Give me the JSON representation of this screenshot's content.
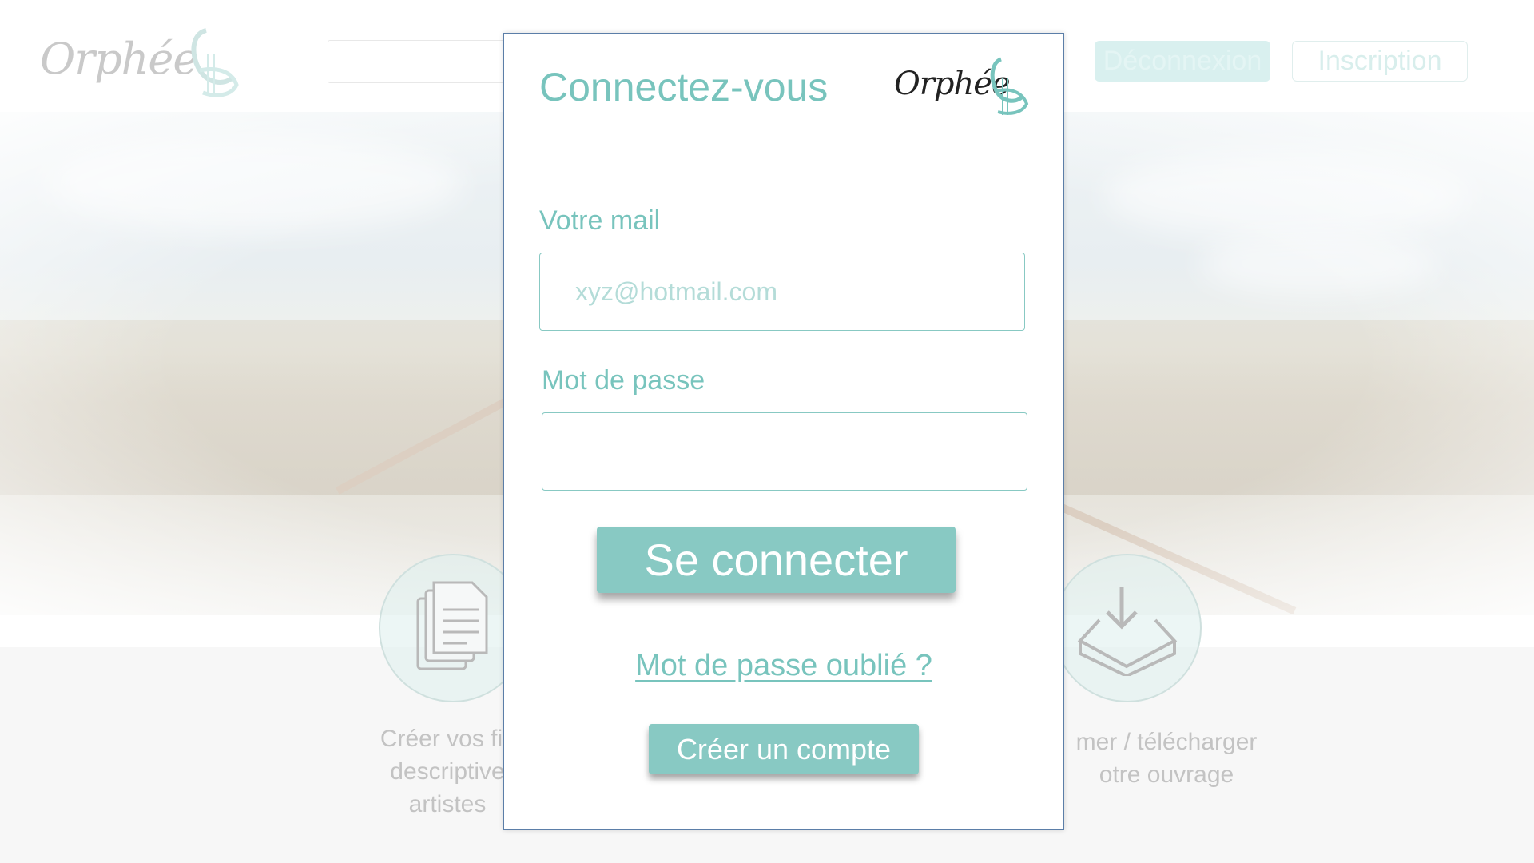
{
  "header": {
    "logo_text": "Orphée",
    "deconnexion_label": "Déconnexion",
    "inscription_label": "Inscription"
  },
  "features": [
    {
      "icon": "documents-icon",
      "text": "Créer vos fic\ndescriptive\nartistes"
    },
    {
      "icon": "download-tray-icon",
      "text": "mer / télécharger\notre ouvrage"
    }
  ],
  "modal": {
    "title": "Connectez-vous",
    "logo_text": "Orphée",
    "email": {
      "label": "Votre mail",
      "placeholder": "xyz@hotmail.com",
      "value": ""
    },
    "password": {
      "label": "Mot de passe",
      "value": ""
    },
    "connect_label": "Se connecter",
    "forgot_label": "Mot de passe oublié ?",
    "create_label": "Créer un compte"
  },
  "colors": {
    "accent": "#88c9c3",
    "accent_text": "#78c4bd",
    "modal_border": "#5b7ea8"
  }
}
